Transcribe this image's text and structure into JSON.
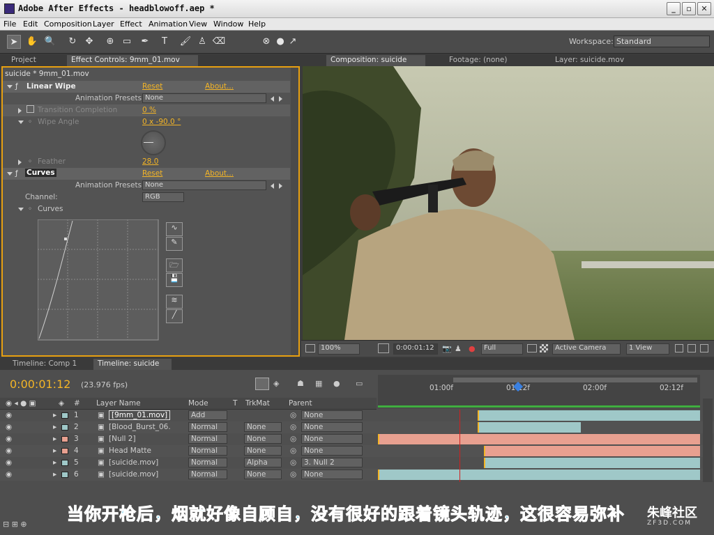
{
  "window": {
    "title": "Adobe After Effects - headblowoff.aep *"
  },
  "menu": [
    "File",
    "Edit",
    "Composition",
    "Layer",
    "Effect",
    "Animation",
    "View",
    "Window",
    "Help"
  ],
  "workspace": {
    "label": "Workspace:",
    "value": "Standard"
  },
  "left_tabs": {
    "project": "Project",
    "effect_controls": "Effect Controls: 9mm_01.mov"
  },
  "effect_controls": {
    "path": "suicide * 9mm_01.mov",
    "linear_wipe": {
      "name": "Linear Wipe",
      "reset": "Reset",
      "about": "About...",
      "presets_label": "Animation Presets:",
      "presets_value": "None",
      "transition_label": "Transition Completion",
      "transition_value": "0 %",
      "wipe_label": "Wipe Angle",
      "wipe_value": "0 x -90.0 °",
      "feather_label": "Feather",
      "feather_value": "28.0"
    },
    "curves": {
      "name": "Curves",
      "reset": "Reset",
      "about": "About...",
      "presets_label": "Animation Presets:",
      "presets_value": "None",
      "channel_label": "Channel:",
      "channel_value": "RGB",
      "curves_label": "Curves"
    }
  },
  "viewer_tabs": {
    "composition": "Composition: suicide",
    "footage": "Footage: (none)",
    "layer": "Layer: suicide.mov"
  },
  "viewer_bar": {
    "zoom": "100%",
    "timecode": "0:00:01:12",
    "resolution": "Full",
    "camera": "Active Camera",
    "views": "1 View"
  },
  "timeline_tabs": {
    "comp1": "Timeline: Comp 1",
    "suicide": "Timeline: suicide"
  },
  "timeline": {
    "timecode": "0:00:01:12",
    "fps": "(23.976 fps)",
    "headers": {
      "num": "#",
      "name": "Layer Name",
      "mode": "Mode",
      "t": "T",
      "trkmat": "TrkMat",
      "parent": "Parent"
    },
    "ruler": [
      "01:00f",
      "01:12f",
      "02:00f",
      "02:12f"
    ],
    "layers": [
      {
        "num": "1",
        "name": "[9mm_01.mov]",
        "mode": "Add",
        "trkmat": "",
        "parent": "None",
        "color": "#9fc8c8"
      },
      {
        "num": "2",
        "name": "[Blood_Burst_06.",
        "mode": "Normal",
        "trkmat": "None",
        "parent": "None",
        "color": "#9fc8c8"
      },
      {
        "num": "3",
        "name": "[Null 2]",
        "mode": "Normal",
        "trkmat": "None",
        "parent": "None",
        "color": "#e8a090"
      },
      {
        "num": "4",
        "name": "Head Matte",
        "mode": "Normal",
        "trkmat": "None",
        "parent": "None",
        "color": "#e8a090"
      },
      {
        "num": "5",
        "name": "[suicide.mov]",
        "mode": "Normal",
        "trkmat": "Alpha",
        "parent": "3. Null 2",
        "color": "#9fc8c8"
      },
      {
        "num": "6",
        "name": "[suicide.mov]",
        "mode": "Normal",
        "trkmat": "None",
        "parent": "None",
        "color": "#9fc8c8"
      }
    ]
  },
  "subtitle": "当你开枪后，烟就好像自顾自，没有很好的跟着镜头轨迹，这很容易弥补",
  "watermark": {
    "name": "朱峰社区",
    "url": "ZF3D.COM"
  }
}
